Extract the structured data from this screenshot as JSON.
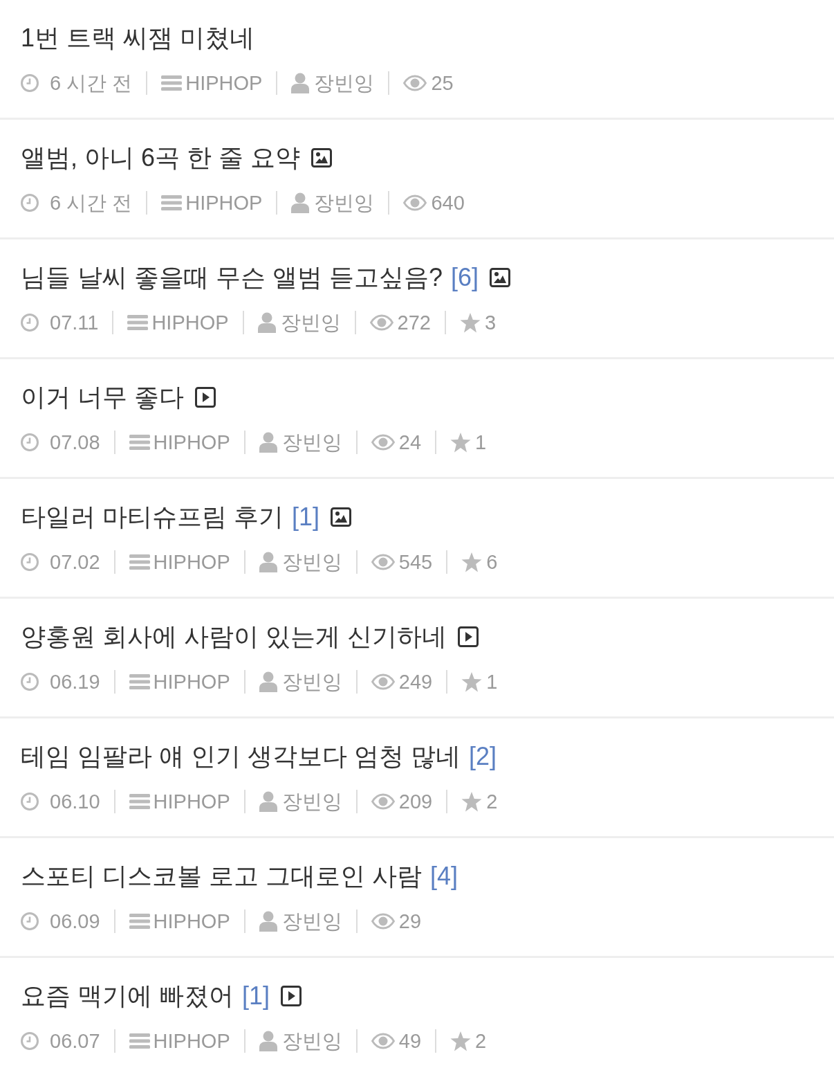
{
  "posts": [
    {
      "kind": "plain",
      "title": "1번 트랙 씨잼 미쳤네",
      "time": "6 시간 전",
      "category": "HIPHOP",
      "author": "장빈잉",
      "views": "25"
    },
    {
      "kind": "image",
      "title": "앨범, 아니 6곡 한 줄 요약",
      "time": "6 시간 전",
      "category": "HIPHOP",
      "author": "장빈잉",
      "views": "640"
    },
    {
      "kind": "image",
      "title": "님들 날씨 좋을때 무슨 앨범 듣고싶음?",
      "comments": "[6]",
      "time": "07.11",
      "category": "HIPHOP",
      "author": "장빈잉",
      "views": "272",
      "likes": "3"
    },
    {
      "kind": "video",
      "title": "이거 너무 좋다",
      "time": "07.08",
      "category": "HIPHOP",
      "author": "장빈잉",
      "views": "24",
      "likes": "1"
    },
    {
      "kind": "image",
      "title": "타일러 마티슈프림 후기",
      "comments": "[1]",
      "time": "07.02",
      "category": "HIPHOP",
      "author": "장빈잉",
      "views": "545",
      "likes": "6"
    },
    {
      "kind": "video",
      "title": "양홍원 회사에 사람이 있는게 신기하네",
      "time": "06.19",
      "category": "HIPHOP",
      "author": "장빈잉",
      "views": "249",
      "likes": "1"
    },
    {
      "kind": "plain",
      "title": "테임 임팔라 얘 인기 생각보다 엄청 많네",
      "comments": "[2]",
      "time": "06.10",
      "category": "HIPHOP",
      "author": "장빈잉",
      "views": "209",
      "likes": "2"
    },
    {
      "kind": "plain",
      "title": "스포티 디스코볼 로고 그대로인 사람",
      "comments": "[4]",
      "time": "06.09",
      "category": "HIPHOP",
      "author": "장빈잉",
      "views": "29"
    },
    {
      "kind": "video",
      "title": "요즘 맥기에 빠졌어",
      "comments": "[1]",
      "time": "06.07",
      "category": "HIPHOP",
      "author": "장빈잉",
      "views": "49",
      "likes": "2"
    }
  ]
}
